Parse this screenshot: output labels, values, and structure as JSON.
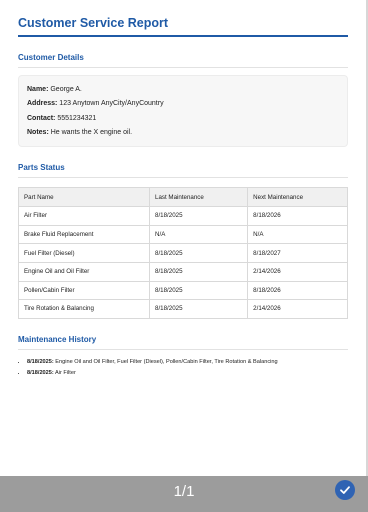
{
  "report": {
    "title": "Customer Service Report"
  },
  "customer": {
    "section_title": "Customer Details",
    "name_label": "Name:",
    "name": "George A.",
    "address_label": "Address:",
    "address": "123 Anytown AnyCity/AnyCountry",
    "contact_label": "Contact:",
    "contact": "5551234321",
    "notes_label": "Notes:",
    "notes": "He wants the X engine oil."
  },
  "parts": {
    "section_title": "Parts Status",
    "headers": [
      "Part Name",
      "Last Maintenance",
      "Next Maintenance"
    ],
    "rows": [
      [
        "Air Filter",
        "8/18/2025",
        "8/18/2026"
      ],
      [
        "Brake Fluid Replacement",
        "N/A",
        "N/A"
      ],
      [
        "Fuel Filter (Diesel)",
        "8/18/2025",
        "8/18/2027"
      ],
      [
        "Engine Oil and Oil Filter",
        "8/18/2025",
        "2/14/2026"
      ],
      [
        "Pollen/Cabin Filter",
        "8/18/2025",
        "8/18/2026"
      ],
      [
        "Tire Rotation & Balancing",
        "8/18/2025",
        "2/14/2026"
      ]
    ]
  },
  "history": {
    "section_title": "Maintenance History",
    "items": [
      {
        "date": "8/18/2025:",
        "text": " Engine Oil and Oil Filter, Fuel Filter (Diesel), Pollen/Cabin Filter, Tire Rotation & Balancing"
      },
      {
        "date": "8/18/2025:",
        "text": " Air Filter"
      }
    ]
  },
  "footer": {
    "page_indicator": "1/1",
    "confirm_icon": "check-circle-icon",
    "accent_color": "#2f63b3"
  }
}
